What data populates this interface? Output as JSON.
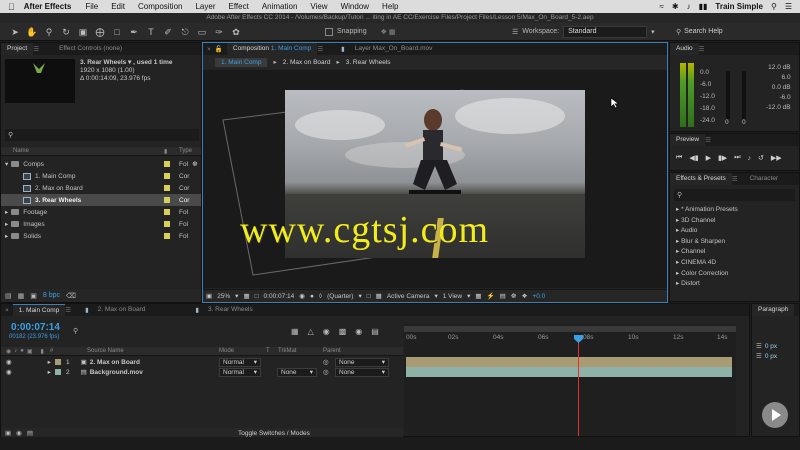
{
  "menubar": {
    "app_name": "After Effects",
    "items": [
      "File",
      "Edit",
      "Composition",
      "Layer",
      "Effect",
      "Animation",
      "View",
      "Window",
      "Help"
    ],
    "user": "Train Simple"
  },
  "titlebar": {
    "text": "Adobe After Effects CC 2014 - /Volumes/Backup/Tutori ... iting in AE CC/Exercise Files/Project Files/Lesson 5/Max_On_Board_5-2.aep"
  },
  "toolbar": {
    "snapping_label": "Snapping",
    "workspace_label": "Workspace:",
    "workspace_value": "Standard",
    "search_placeholder": "Search Help"
  },
  "project": {
    "tab_project": "Project",
    "tab_effect_controls": "Effect Controls (none)",
    "selected_name": "3. Rear Wheels ▾ , used 1 time",
    "selected_size": "1920 x 1080 (1.00)",
    "selected_duration": "Δ 0:00:14:09, 23.976 fps",
    "col_name": "Name",
    "col_type": "Type",
    "rows": [
      {
        "name": "Comps",
        "type": "Fol",
        "kind": "folder",
        "color": "#d6d05a"
      },
      {
        "name": "1. Main Comp",
        "type": "Cor",
        "kind": "comp",
        "color": "#d6d05a"
      },
      {
        "name": "2. Max on Board",
        "type": "Cor",
        "kind": "comp",
        "color": "#d6d05a"
      },
      {
        "name": "3. Rear Wheels",
        "type": "Cor",
        "kind": "comp",
        "color": "#d6d05a"
      },
      {
        "name": "Footage",
        "type": "Fol",
        "kind": "folder",
        "color": "#d6d05a"
      },
      {
        "name": "Images",
        "type": "Fol",
        "kind": "folder",
        "color": "#d6d05a"
      },
      {
        "name": "Solids",
        "type": "Fol",
        "kind": "folder",
        "color": "#d6d05a"
      }
    ],
    "bpc_label": "8 bpc"
  },
  "composition": {
    "tab_label": "Composition",
    "tab_comp_name": "1. Main Comp",
    "layer_tab": "Layer Max_On_Board.mov",
    "breadcrumbs": [
      "1. Main Comp",
      "2. Max on Board",
      "3. Rear Wheels"
    ],
    "zoom": "25%",
    "timecode": "0:00:07:14",
    "resolution": "(Quarter)",
    "camera": "Active Camera",
    "view": "1 View",
    "exposure": "+0.0",
    "watermark": "www.cgtsj.com"
  },
  "audio": {
    "title": "Audio",
    "levels_left": [
      "0.0",
      "-6.0",
      "-12.0",
      "-18.0",
      "-24.0"
    ],
    "levels_right": [
      "12.0 dB",
      "6.0",
      "0.0 dB",
      "-6.0",
      "-12.0 dB"
    ],
    "zeros": [
      "0",
      "0"
    ]
  },
  "preview": {
    "title": "Preview"
  },
  "effects": {
    "tab_effects": "Effects & Presets",
    "tab_character": "Character",
    "items": [
      "* Animation Presets",
      "3D Channel",
      "Audio",
      "Blur & Sharpen",
      "Channel",
      "CINEMA 4D",
      "Color Correction",
      "Distort"
    ]
  },
  "timeline": {
    "tabs": [
      "1. Main Comp",
      "2. Max on Board",
      "3. Rear Wheels"
    ],
    "timecode": "0:00:07:14",
    "frames": "00182 (23.976 fps)",
    "col_source": "Source Name",
    "col_mode": "Mode",
    "col_t": "T",
    "col_trkmat": "TrkMat",
    "col_parent": "Parent",
    "layers": [
      {
        "num": "1",
        "name": "2. Max on Board",
        "mode": "Normal",
        "trkmat": "",
        "parent": "None",
        "color": "#a99c74"
      },
      {
        "num": "2",
        "name": "Background.mov",
        "mode": "Normal",
        "trkmat": "None",
        "parent": "None",
        "color": "#8fb2a8"
      }
    ],
    "ruler": [
      "00s",
      "02s",
      "04s",
      "06s",
      "08s",
      "10s",
      "12s",
      "14s"
    ],
    "toggle_label": "Toggle Switches / Modes"
  },
  "paragraph": {
    "title": "Paragraph",
    "values": [
      "0 px",
      "0 px"
    ]
  }
}
